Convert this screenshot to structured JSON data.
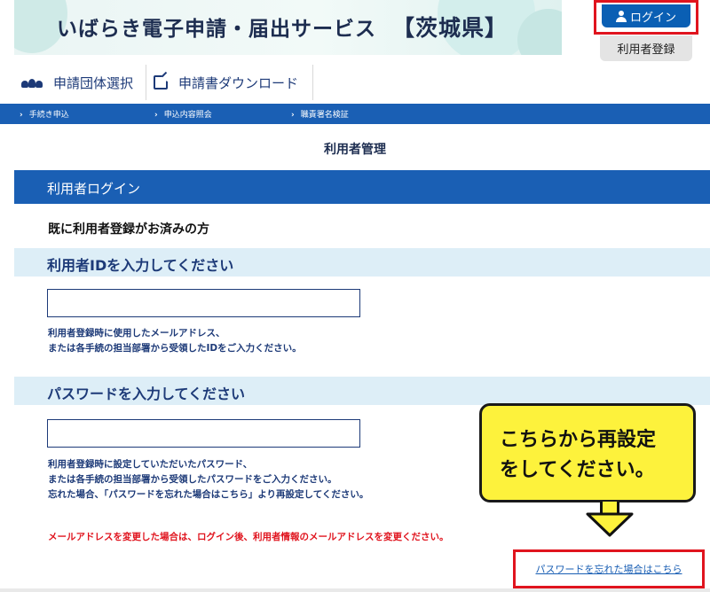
{
  "header": {
    "title": "いばらき電子申請・届出サービス",
    "prefecture": "【茨城県】",
    "login_label": "ログイン",
    "register_label": "利用者登録"
  },
  "nav": {
    "tabs": [
      {
        "label": "申請団体選択",
        "icon": "people-icon"
      },
      {
        "label": "申請書ダウンロード",
        "icon": "download-form-icon"
      }
    ]
  },
  "subnav": {
    "items": [
      "手続き申込",
      "申込内容照会",
      "職責署名検証"
    ]
  },
  "page": {
    "title": "利用者管理",
    "login_header": "利用者ログイン",
    "registered_label": "既に利用者登録がお済みの方"
  },
  "user_id": {
    "heading": "利用者IDを入力してください",
    "value": "",
    "help_line1": "利用者登録時に使用したメールアドレス、",
    "help_line2": "または各手続の担当部署から受領したIDをご入力ください。"
  },
  "password": {
    "heading": "パスワードを入力してください",
    "value": "",
    "help_line1": "利用者登録時に設定していただいたパスワード、",
    "help_line2": "または各手続の担当部署から受領したパスワードをご入力ください。",
    "help_line3": "忘れた場合、「パスワードを忘れた場合はこちら」より再設定してください。"
  },
  "warning": "メールアドレスを変更した場合は、ログイン後、利用者情報のメールアドレスを変更ください。",
  "callout": {
    "line1": "こちらから再設定",
    "line2": "をしてください。"
  },
  "forgot_link": "パスワードを忘れた場合はこちら",
  "colors": {
    "primary": "#1a5fb4",
    "highlight": "#e0141e",
    "callout": "#fdf23c"
  }
}
